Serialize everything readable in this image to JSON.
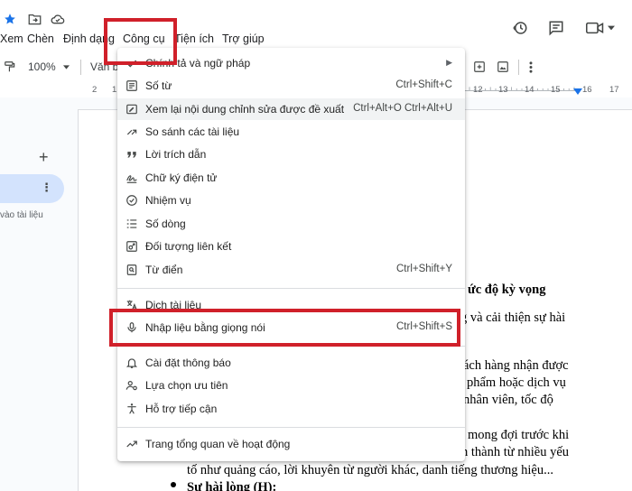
{
  "menubar": {
    "items": [
      "Xem",
      "Chèn",
      "Định dạng",
      "Công cụ",
      "Tiện ích",
      "Trợ giúp"
    ]
  },
  "toolbar": {
    "zoom": "100%",
    "style_partial": "Văn b"
  },
  "ruler": {
    "labels": [
      "2",
      "1",
      "12",
      "13",
      "14",
      "15",
      "16",
      "17"
    ]
  },
  "sidebar": {
    "hint": "vào tài liệu"
  },
  "tools_menu": {
    "items": [
      {
        "label": "Chính tả và ngữ pháp",
        "shortcut": "",
        "icon": "spellcheck-icon",
        "submenu": true
      },
      {
        "label": "Số từ",
        "shortcut": "Ctrl+Shift+C",
        "icon": "word-count-icon"
      },
      {
        "label": "Xem lại nội dung chỉnh sửa được đề xuất",
        "shortcut": "Ctrl+Alt+O Ctrl+Alt+U",
        "icon": "review-edits-icon"
      },
      {
        "label": "So sánh các tài liệu",
        "shortcut": "",
        "icon": "compare-icon"
      },
      {
        "label": "Lời trích dẫn",
        "shortcut": "",
        "icon": "quote-icon"
      },
      {
        "label": "Chữ ký điện tử",
        "shortcut": "",
        "icon": "signature-icon"
      },
      {
        "label": "Nhiệm vụ",
        "shortcut": "",
        "icon": "task-icon"
      },
      {
        "label": "Số dòng",
        "shortcut": "",
        "icon": "line-numbers-icon"
      },
      {
        "label": "Đối tượng liên kết",
        "shortcut": "",
        "icon": "linked-objects-icon"
      },
      {
        "label": "Từ điển",
        "shortcut": "Ctrl+Shift+Y",
        "icon": "dictionary-icon"
      },
      {
        "label": "Dịch tài liệu",
        "shortcut": "",
        "icon": "translate-icon"
      },
      {
        "label": "Nhập liệu bằng giọng nói",
        "shortcut": "Ctrl+Shift+S",
        "icon": "microphone-icon"
      },
      {
        "label": "Cài đặt thông báo",
        "shortcut": "",
        "icon": "bell-icon"
      },
      {
        "label": "Lựa chọn ưu tiên",
        "shortcut": "",
        "icon": "preferences-icon"
      },
      {
        "label": "Hỗ trợ tiếp cận",
        "shortcut": "",
        "icon": "accessibility-icon"
      },
      {
        "label": "Trang tổng quan về hoạt động",
        "shortcut": "",
        "icon": "activity-icon"
      }
    ]
  },
  "document": {
    "lines": [
      "ức độ kỳ vọng",
      "g và cải thiện sự hài",
      "ách hàng nhận được",
      "phẩm hoặc dịch vụ",
      "nhân viên, tốc độ",
      "mong đợi trước khi",
      "n thành từ nhiều yếu",
      "tố như quảng cáo, lời khuyên từ người khác, danh tiếng thương hiệu...",
      "Sự hài lòng (H):"
    ]
  },
  "colors": {
    "accent": "#d3e3fd",
    "annotation_red": "#d0202a",
    "star": "#1a73e8"
  }
}
